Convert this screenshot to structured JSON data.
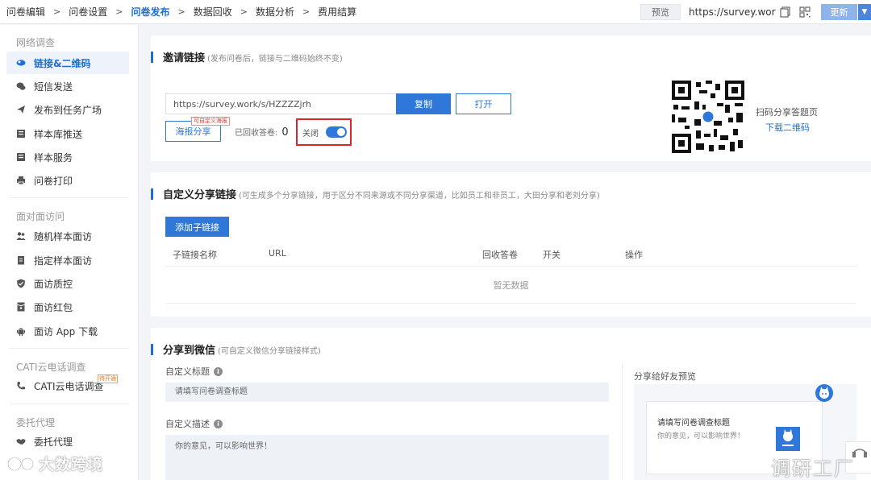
{
  "topbar": {
    "steps": [
      "问卷编辑",
      "问卷设置",
      "问卷发布",
      "数据回收",
      "数据分析",
      "费用结算"
    ],
    "active_step": "问卷发布",
    "preview_label": "预览",
    "survey_url": "https://survey.work/s/",
    "update_label": "更新"
  },
  "sidebar": {
    "sections": [
      {
        "title": "网络调查",
        "items": [
          {
            "label": "链接&二维码",
            "icon": "link-icon",
            "active": true
          },
          {
            "label": "短信发送",
            "icon": "sms-icon"
          },
          {
            "label": "发布到任务广场",
            "icon": "send-icon"
          },
          {
            "label": "样本库推送",
            "icon": "sample-library-icon"
          },
          {
            "label": "样本服务",
            "icon": "sample-service-icon"
          },
          {
            "label": "问卷打印",
            "icon": "printer-icon"
          }
        ]
      },
      {
        "title": "面对面访问",
        "items": [
          {
            "label": "随机样本面访",
            "icon": "people-icon"
          },
          {
            "label": "指定样本面访",
            "icon": "clipboard-icon"
          },
          {
            "label": "面访质控",
            "icon": "shield-icon"
          },
          {
            "label": "面访红包",
            "icon": "red-packet-icon"
          },
          {
            "label": "面访 App 下载",
            "icon": "android-icon"
          }
        ]
      },
      {
        "title": "CATI云电话调查",
        "items": [
          {
            "label": "CATI云电话调查",
            "icon": "phone-icon",
            "badge": "待开通"
          }
        ]
      },
      {
        "title": "委托代理",
        "items": [
          {
            "label": "委托代理",
            "icon": "handshake-icon"
          }
        ]
      }
    ]
  },
  "invite": {
    "title": "邀请链接",
    "subtitle": "(发布问卷后，链接与二维码始终不变)",
    "link_value": "https://survey.work/s/HZZZZjrh",
    "copy_label": "复制",
    "open_label": "打开",
    "poster_label": "海报分享",
    "poster_tag": "可自定义海报",
    "collected_label": "已回收答卷:",
    "collected_count": "0",
    "toggle_label": "关闭",
    "toggle_on": true,
    "qr_text": "扫码分享答题页",
    "qr_download": "下载二维码"
  },
  "custom_links": {
    "title": "自定义分享链接",
    "subtitle": "(可生成多个分享链接，用于区分不同来源或不同分享渠道，比如员工和非员工，大田分享和老刘分享)",
    "add_label": "添加子链接",
    "columns": [
      "子链接名称",
      "URL",
      "回收答卷",
      "开关",
      "操作"
    ],
    "empty_text": "暂无数据"
  },
  "wechat": {
    "title": "分享到微信",
    "subtitle": "(可自定义微信分享链接样式)",
    "custom_title_label": "自定义标题",
    "custom_title_placeholder": "请填写问卷调查标题",
    "custom_desc_label": "自定义描述",
    "custom_desc_value": "你的意见，可以影响世界！",
    "preview_label": "分享给好友预览",
    "preview_title": "请填写问卷调查标题",
    "preview_desc": "你的意见，可以影响世界！"
  },
  "watermarks": {
    "left": "大数跨境",
    "right": "调研工厂"
  },
  "colors": {
    "accent": "#2f78d9",
    "highlight_box": "#d9252a",
    "sidebar_active_bg": "#eef2fb"
  }
}
